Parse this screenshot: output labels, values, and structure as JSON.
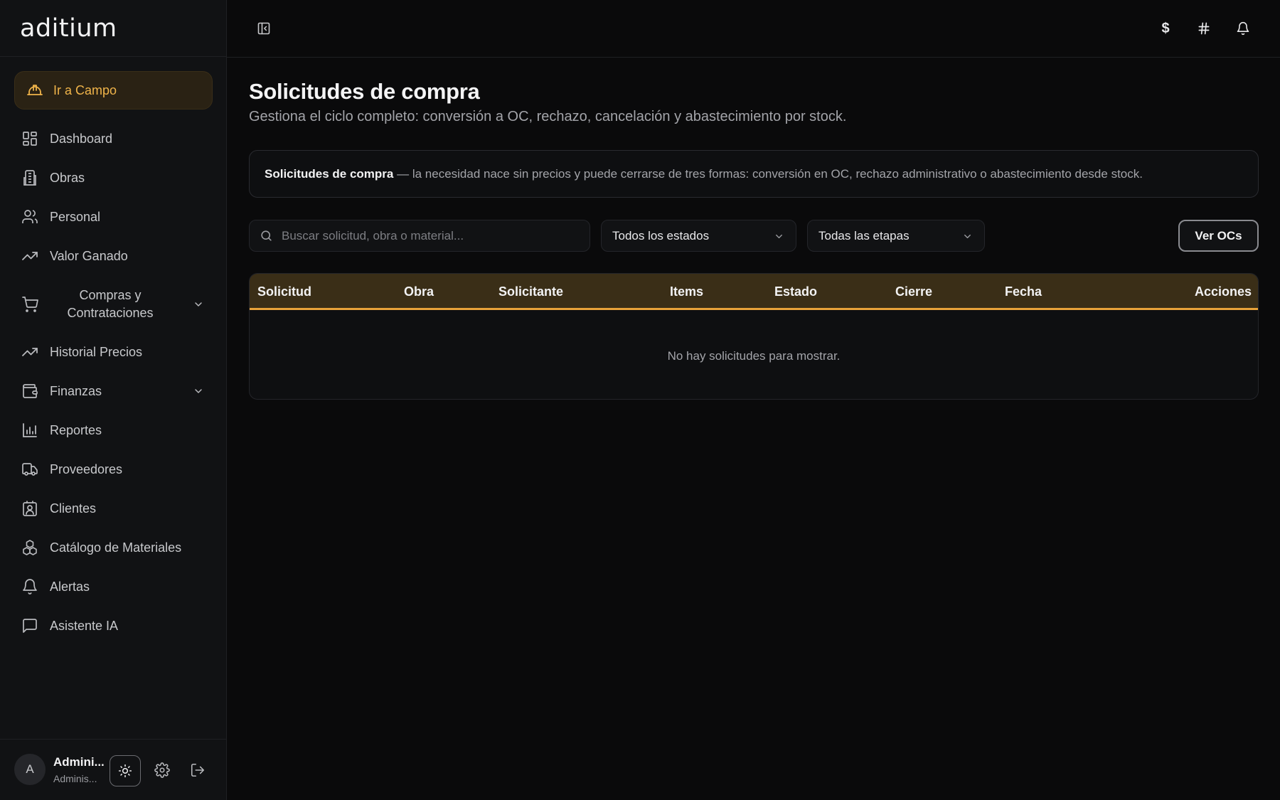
{
  "brand": {
    "name": "aditium"
  },
  "sidebar": {
    "campo_label": "Ir a Campo",
    "items": [
      {
        "label": "Dashboard",
        "icon": "dashboard-icon"
      },
      {
        "label": "Obras",
        "icon": "building-icon"
      },
      {
        "label": "Personal",
        "icon": "users-icon"
      },
      {
        "label": "Valor Ganado",
        "icon": "trending-up-icon"
      },
      {
        "label": "Compras y Contrataciones",
        "icon": "cart-icon",
        "expandable": true
      },
      {
        "label": "Historial Precios",
        "icon": "trending-up-icon"
      },
      {
        "label": "Finanzas",
        "icon": "wallet-icon",
        "expandable": true
      },
      {
        "label": "Reportes",
        "icon": "bar-chart-icon"
      },
      {
        "label": "Proveedores",
        "icon": "truck-icon"
      },
      {
        "label": "Clientes",
        "icon": "contact-icon"
      },
      {
        "label": "Catálogo de Materiales",
        "icon": "boxes-icon"
      },
      {
        "label": "Alertas",
        "icon": "bell-icon"
      },
      {
        "label": "Asistente IA",
        "icon": "message-icon"
      }
    ]
  },
  "user": {
    "initial": "A",
    "name": "Admini...",
    "role": "Adminis..."
  },
  "topbar": {
    "icons": [
      "dollar-icon",
      "hash-icon",
      "bell-icon"
    ],
    "dollar_glyph": "$",
    "hash_glyph": "#"
  },
  "main": {
    "title": "Solicitudes de compra",
    "subtitle": "Gestiona el ciclo completo: conversión a OC, rechazo, cancelación y abastecimiento por stock.",
    "info_bold": "Solicitudes de compra",
    "info_text": " — la necesidad nace sin precios y puede cerrarse de tres formas: conversión en OC, rechazo administrativo o abastecimiento desde stock.",
    "search_placeholder": "Buscar solicitud, obra o material...",
    "filter_status": "Todos los estados",
    "filter_stage": "Todas las etapas",
    "ver_ocs_label": "Ver OCs",
    "table": {
      "columns": [
        "Solicitud",
        "Obra",
        "Solicitante",
        "Items",
        "Estado",
        "Cierre",
        "Fecha",
        "Acciones"
      ],
      "empty_message": "No hay solicitudes para mostrar."
    }
  },
  "colors": {
    "accent": "#e8a23a",
    "campo_text": "#f0b44a",
    "header_bg": "#3a2e17"
  }
}
